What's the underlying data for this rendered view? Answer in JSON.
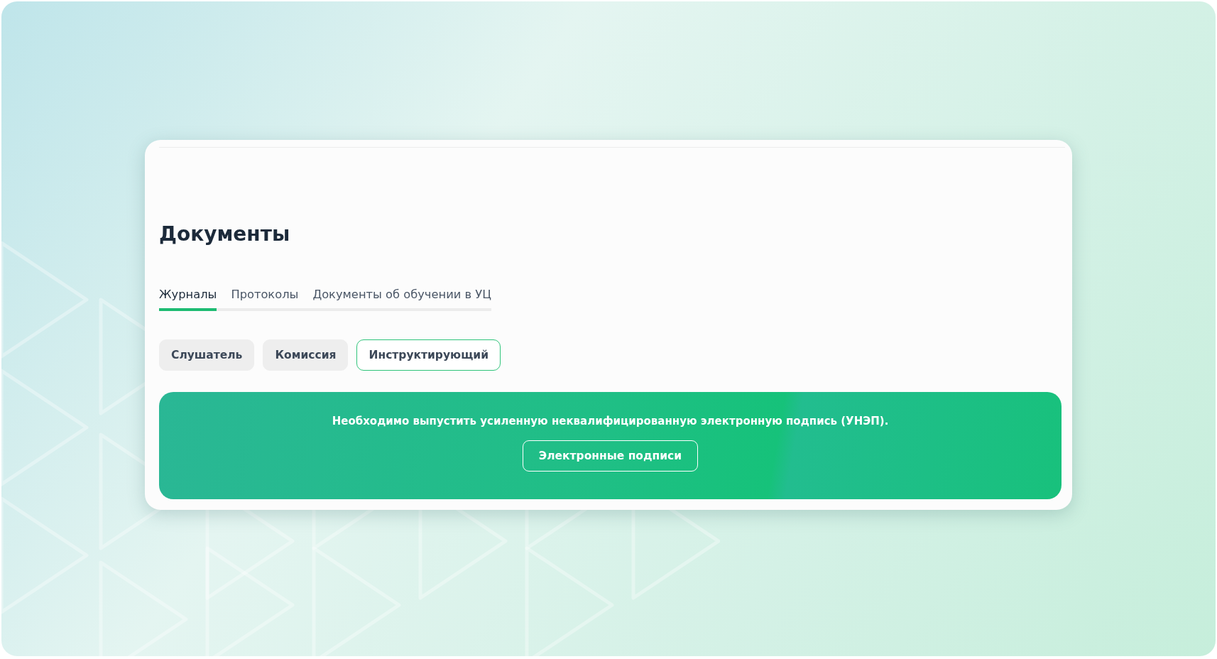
{
  "page": {
    "title": "Документы"
  },
  "tabs": [
    {
      "label": "Журналы",
      "selected": true
    },
    {
      "label": "Протоколы",
      "selected": false
    },
    {
      "label": "Документы об обучении в УЦ",
      "selected": false
    }
  ],
  "roles": [
    {
      "label": "Слушатель",
      "selected": false
    },
    {
      "label": "Комиссия",
      "selected": false
    },
    {
      "label": "Инструктирующий",
      "selected": true
    }
  ],
  "notice": {
    "message": "Необходимо выпустить усиленную неквалифицированную электронную подпись (УНЭП).",
    "button": "Электронные подписи"
  }
}
